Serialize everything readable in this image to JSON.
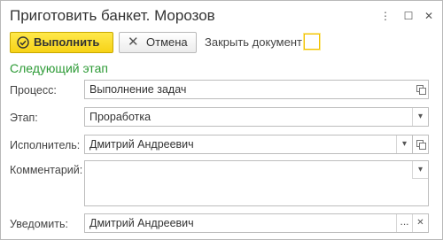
{
  "window": {
    "title": "Приготовить банкет. Морозов",
    "more_glyph": "⋮",
    "maximize_glyph": "☐",
    "close_glyph": "✕"
  },
  "toolbar": {
    "execute_label": "Выполнить",
    "cancel_label": "Отмена",
    "cancel_glyph": "✕",
    "close_doc_label": "Закрыть документ:",
    "close_doc_checked": false
  },
  "section": {
    "title": "Следующий этап"
  },
  "fields": {
    "process": {
      "label": "Процесс:",
      "value": "Выполнение задач"
    },
    "stage": {
      "label": "Этап:",
      "value": "Проработка"
    },
    "executor": {
      "label": "Исполнитель:",
      "value": "Дмитрий Андреевич"
    },
    "comment": {
      "label": "Комментарий:",
      "value": ""
    },
    "notify": {
      "label": "Уведомить:",
      "value": "Дмитрий Андреевич"
    }
  },
  "glyphs": {
    "dropdown": "▾",
    "ellipsis": "...",
    "clear": "✕"
  },
  "colors": {
    "accent_yellow": "#f7d317",
    "section_green": "#2c9a35"
  }
}
